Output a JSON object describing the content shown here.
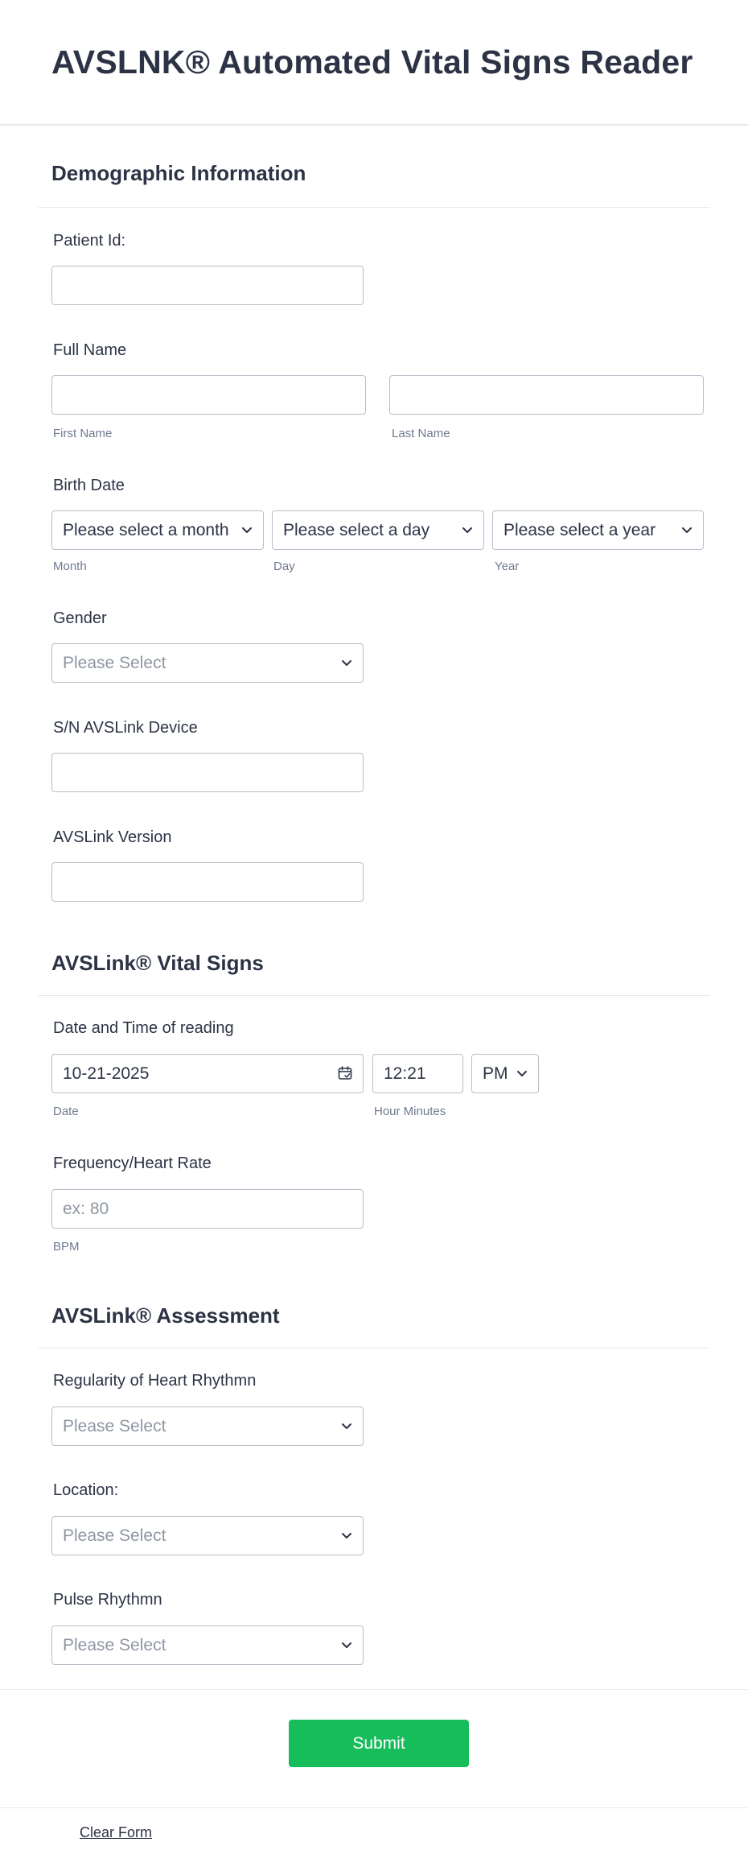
{
  "form_title": "AVSLNK® Automated Vital Signs Reader",
  "sections": {
    "demographic": "Demographic Information",
    "vital_signs": "AVSLink® Vital Signs",
    "assessment": "AVSLink® Assessment"
  },
  "patient_id": {
    "label": "Patient Id:",
    "value": ""
  },
  "full_name": {
    "label": "Full Name",
    "first_sublabel": "First Name",
    "last_sublabel": "Last Name"
  },
  "birth_date": {
    "label": "Birth Date",
    "month_value": "Please select a month",
    "day_value": "Please select a day",
    "year_value": "Please select a year",
    "month_sublabel": "Month",
    "day_sublabel": "Day",
    "year_sublabel": "Year"
  },
  "gender": {
    "label": "Gender",
    "placeholder": "Please Select"
  },
  "serial": {
    "label": "S/N AVSLink Device"
  },
  "version": {
    "label": "AVSLink Version"
  },
  "datetime": {
    "label": "Date and Time of reading",
    "date_value": "10-21-2025",
    "time_value": "12:21",
    "ampm_value": "PM",
    "date_sublabel": "Date",
    "time_sublabel": "Hour Minutes"
  },
  "heart_rate": {
    "label": "Frequency/Heart Rate",
    "placeholder": "ex: 80",
    "sublabel": "BPM"
  },
  "regularity": {
    "label": "Regularity of Heart Rhythmn",
    "placeholder": "Please Select"
  },
  "location": {
    "label": "Location:",
    "placeholder": "Please Select"
  },
  "pulse": {
    "label": "Pulse Rhythmn",
    "placeholder": "Please Select"
  },
  "submit_label": "Submit",
  "clear_label": "Clear Form",
  "icons": {
    "chevron": "chevron-down-icon",
    "calendar": "calendar-icon"
  },
  "colors": {
    "accent": "#18bd5b",
    "text": "#2c3345",
    "border": "#b8bdc9"
  }
}
